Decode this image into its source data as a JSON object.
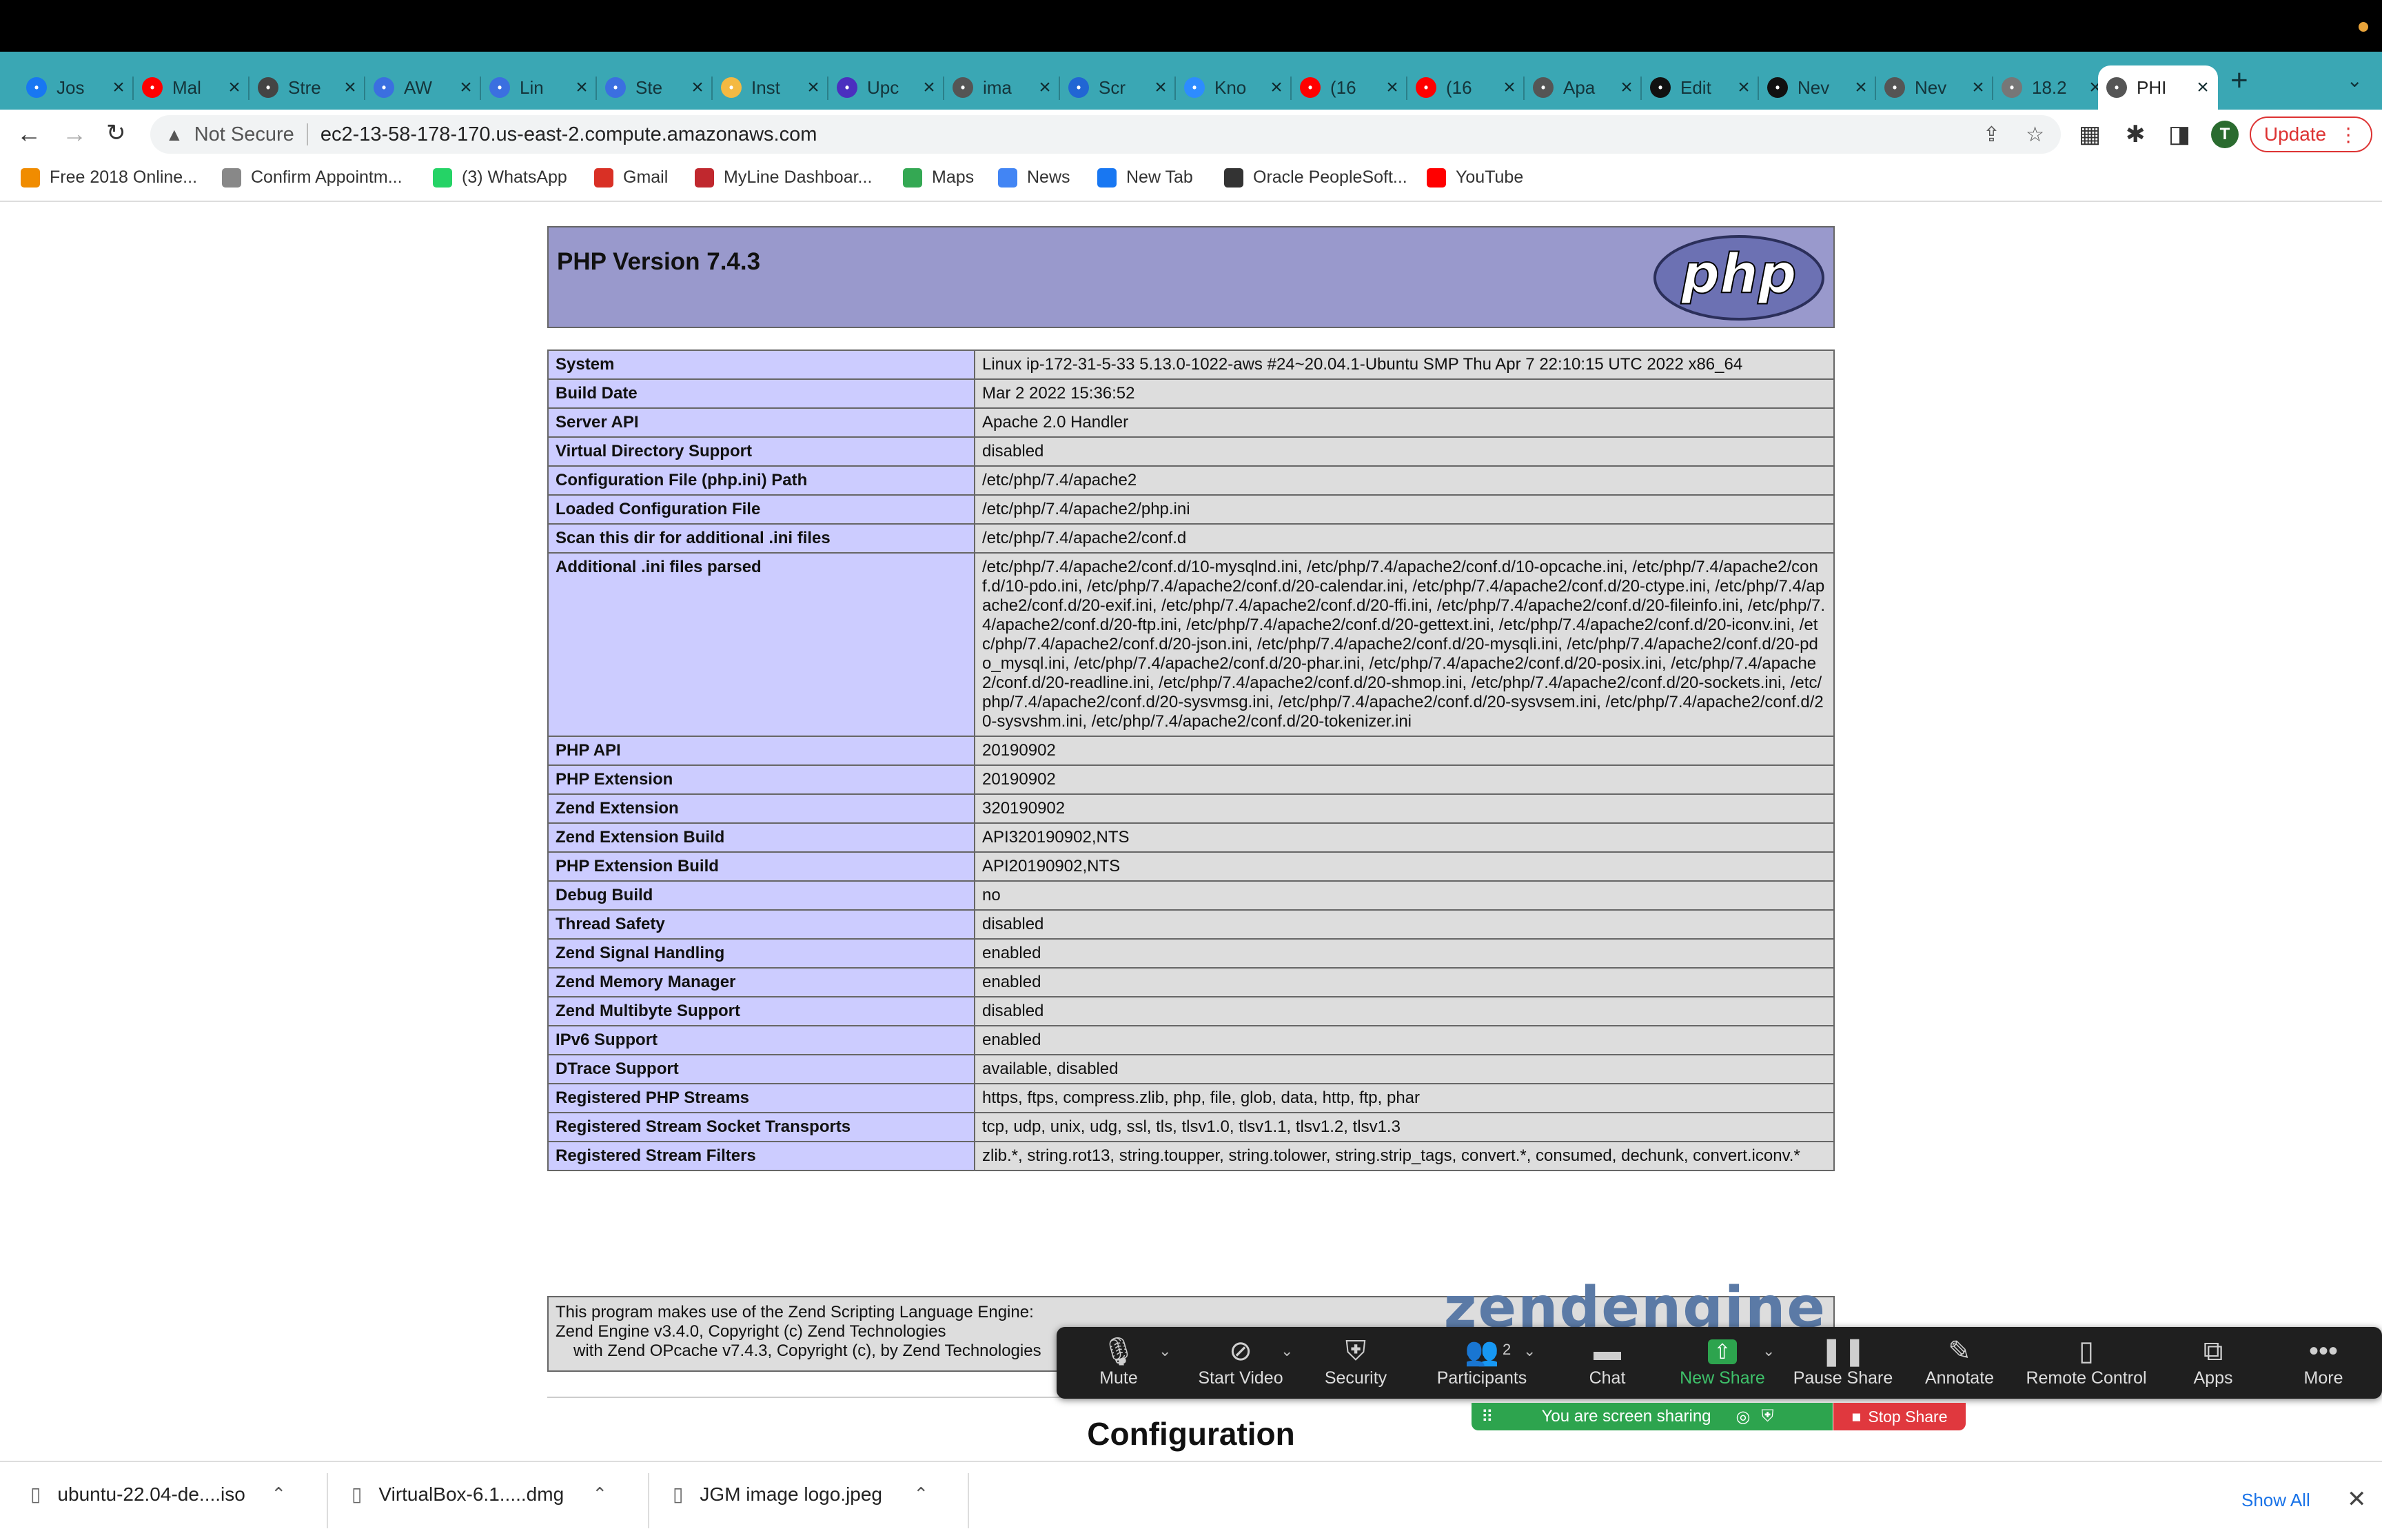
{
  "browser": {
    "tabs": [
      {
        "title": "Jos",
        "icon": "facebook-icon",
        "color": "#1877f2"
      },
      {
        "title": "Mal",
        "icon": "youtube-icon",
        "color": "#ff0000"
      },
      {
        "title": "Stre",
        "icon": "stream-icon",
        "color": "#444444"
      },
      {
        "title": "AW",
        "icon": "aws-icon",
        "color": "#3b6fe0"
      },
      {
        "title": "Lin",
        "icon": "linux-icon",
        "color": "#3b6fe0"
      },
      {
        "title": "Ste",
        "icon": "steps-icon",
        "color": "#3b6fe0"
      },
      {
        "title": "Inst",
        "icon": "install-icon",
        "color": "#f4b942"
      },
      {
        "title": "Upc",
        "icon": "upcoming-icon",
        "color": "#4b2fbf"
      },
      {
        "title": "ima",
        "icon": "globe-icon",
        "color": "#555555"
      },
      {
        "title": "Scr",
        "icon": "screen-icon",
        "color": "#2166d4"
      },
      {
        "title": "Kno",
        "icon": "zoom-icon",
        "color": "#2d8cff"
      },
      {
        "title": "(16",
        "icon": "youtube-icon",
        "color": "#ff0000"
      },
      {
        "title": "(16",
        "icon": "youtube-icon",
        "color": "#ff0000"
      },
      {
        "title": "Apa",
        "icon": "globe-icon",
        "color": "#555555"
      },
      {
        "title": "Edit",
        "icon": "github-icon",
        "color": "#111111"
      },
      {
        "title": "Nev",
        "icon": "github-icon",
        "color": "#111111"
      },
      {
        "title": "Nev",
        "icon": "chrome-icon",
        "color": "#555555"
      },
      {
        "title": "18.2",
        "icon": "globe-icon",
        "color": "#777777"
      },
      {
        "title": "PHI",
        "icon": "globe-icon",
        "color": "#555555",
        "active": true
      }
    ],
    "security_label": "Not Secure",
    "url": "ec2-13-58-178-170.us-east-2.compute.amazonaws.com",
    "profile_initial": "T",
    "update_label": "Update",
    "bookmarks": [
      {
        "label": "Free 2018 Online...",
        "icon": "bookmark-cone-icon",
        "color": "#f08c00"
      },
      {
        "label": "Confirm Appointm...",
        "icon": "page-icon",
        "color": "#888888"
      },
      {
        "label": "(3) WhatsApp",
        "icon": "whatsapp-icon",
        "color": "#25d366"
      },
      {
        "label": "Gmail",
        "icon": "gmail-icon",
        "color": "#d93025"
      },
      {
        "label": "MyLine Dashboar...",
        "icon": "myline-icon",
        "color": "#c0282e"
      },
      {
        "label": "Maps",
        "icon": "maps-icon",
        "color": "#34a853"
      },
      {
        "label": "News",
        "icon": "news-icon",
        "color": "#4285f4"
      },
      {
        "label": "New Tab",
        "icon": "facebook-icon",
        "color": "#1877f2"
      },
      {
        "label": "Oracle PeopleSoft...",
        "icon": "oracle-icon",
        "color": "#333333"
      },
      {
        "label": "YouTube",
        "icon": "youtube-icon",
        "color": "#ff0000"
      }
    ]
  },
  "php": {
    "version_title": "PHP Version 7.4.3",
    "logo_text": "php",
    "rows": [
      {
        "key": "System",
        "value": "Linux ip-172-31-5-33 5.13.0-1022-aws #24~20.04.1-Ubuntu SMP Thu Apr 7 22:10:15 UTC 2022 x86_64"
      },
      {
        "key": "Build Date",
        "value": "Mar 2 2022 15:36:52"
      },
      {
        "key": "Server API",
        "value": "Apache 2.0 Handler"
      },
      {
        "key": "Virtual Directory Support",
        "value": "disabled"
      },
      {
        "key": "Configuration File (php.ini) Path",
        "value": "/etc/php/7.4/apache2"
      },
      {
        "key": "Loaded Configuration File",
        "value": "/etc/php/7.4/apache2/php.ini"
      },
      {
        "key": "Scan this dir for additional .ini files",
        "value": "/etc/php/7.4/apache2/conf.d"
      },
      {
        "key": "Additional .ini files parsed",
        "value": "/etc/php/7.4/apache2/conf.d/10-mysqlnd.ini, /etc/php/7.4/apache2/conf.d/10-opcache.ini, /etc/php/7.4/apache2/conf.d/10-pdo.ini, /etc/php/7.4/apache2/conf.d/20-calendar.ini, /etc/php/7.4/apache2/conf.d/20-ctype.ini, /etc/php/7.4/apache2/conf.d/20-exif.ini, /etc/php/7.4/apache2/conf.d/20-ffi.ini, /etc/php/7.4/apache2/conf.d/20-fileinfo.ini, /etc/php/7.4/apache2/conf.d/20-ftp.ini, /etc/php/7.4/apache2/conf.d/20-gettext.ini, /etc/php/7.4/apache2/conf.d/20-iconv.ini, /etc/php/7.4/apache2/conf.d/20-json.ini, /etc/php/7.4/apache2/conf.d/20-mysqli.ini, /etc/php/7.4/apache2/conf.d/20-pdo_mysql.ini, /etc/php/7.4/apache2/conf.d/20-phar.ini, /etc/php/7.4/apache2/conf.d/20-posix.ini, /etc/php/7.4/apache2/conf.d/20-readline.ini, /etc/php/7.4/apache2/conf.d/20-shmop.ini, /etc/php/7.4/apache2/conf.d/20-sockets.ini, /etc/php/7.4/apache2/conf.d/20-sysvmsg.ini, /etc/php/7.4/apache2/conf.d/20-sysvsem.ini, /etc/php/7.4/apache2/conf.d/20-sysvshm.ini, /etc/php/7.4/apache2/conf.d/20-tokenizer.ini"
      },
      {
        "key": "PHP API",
        "value": "20190902"
      },
      {
        "key": "PHP Extension",
        "value": "20190902"
      },
      {
        "key": "Zend Extension",
        "value": "320190902"
      },
      {
        "key": "Zend Extension Build",
        "value": "API320190902,NTS"
      },
      {
        "key": "PHP Extension Build",
        "value": "API20190902,NTS"
      },
      {
        "key": "Debug Build",
        "value": "no"
      },
      {
        "key": "Thread Safety",
        "value": "disabled"
      },
      {
        "key": "Zend Signal Handling",
        "value": "enabled"
      },
      {
        "key": "Zend Memory Manager",
        "value": "enabled"
      },
      {
        "key": "Zend Multibyte Support",
        "value": "disabled"
      },
      {
        "key": "IPv6 Support",
        "value": "enabled"
      },
      {
        "key": "DTrace Support",
        "value": "available, disabled"
      },
      {
        "key": "Registered PHP Streams",
        "value": "https, ftps, compress.zlib, php, file, glob, data, http, ftp, phar"
      },
      {
        "key": "Registered Stream Socket Transports",
        "value": "tcp, udp, unix, udg, ssl, tls, tlsv1.0, tlsv1.1, tlsv1.2, tlsv1.3"
      },
      {
        "key": "Registered Stream Filters",
        "value": "zlib.*, string.rot13, string.toupper, string.tolower, string.strip_tags, convert.*, consumed, dechunk, convert.iconv.*"
      }
    ],
    "zend_line1": "This program makes use of the Zend Scripting Language Engine:",
    "zend_line2": "Zend Engine v3.4.0, Copyright (c) Zend Technologies",
    "zend_line3": "with Zend OPcache v7.4.3, Copyright (c), by Zend Technologies",
    "zend_logo_text": "zendengine",
    "configuration_heading": "Configuration"
  },
  "zoom": {
    "items": [
      {
        "label": "Mute",
        "icon": "microphone-icon"
      },
      {
        "label": "Start Video",
        "icon": "video-off-icon"
      },
      {
        "label": "Security",
        "icon": "shield-icon"
      },
      {
        "label": "Participants",
        "icon": "participants-icon",
        "count": "2"
      },
      {
        "label": "Chat",
        "icon": "chat-icon"
      },
      {
        "label": "New Share",
        "icon": "share-icon"
      },
      {
        "label": "Pause Share",
        "icon": "pause-icon"
      },
      {
        "label": "Annotate",
        "icon": "pencil-icon"
      },
      {
        "label": "Remote Control",
        "icon": "mouse-icon"
      },
      {
        "label": "Apps",
        "icon": "apps-icon"
      },
      {
        "label": "More",
        "icon": "more-icon"
      }
    ],
    "sharing_text": "You are screen sharing",
    "stop_share": "Stop Share"
  },
  "downloads": {
    "items": [
      {
        "name": "ubuntu-22.04-de....iso"
      },
      {
        "name": "VirtualBox-6.1.....dmg"
      },
      {
        "name": "JGM image logo.jpeg"
      }
    ],
    "show_all": "Show All"
  }
}
